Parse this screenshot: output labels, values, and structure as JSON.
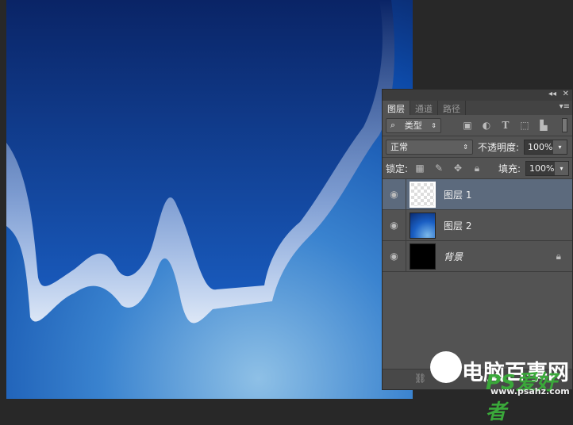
{
  "panel": {
    "tabs": [
      {
        "label": "图层",
        "active": true
      },
      {
        "label": "通道",
        "active": false
      },
      {
        "label": "路径",
        "active": false
      }
    ],
    "filter": {
      "label": "类型",
      "icons": [
        "image-filter-icon",
        "adjustment-filter-icon",
        "type-filter-icon",
        "shape-filter-icon",
        "smart-object-filter-icon"
      ]
    },
    "blend_mode": "正常",
    "opacity_label": "不透明度:",
    "opacity": "100%",
    "lock_label": "锁定:",
    "fill_label": "填充:",
    "fill": "100%",
    "layers": [
      {
        "name": "图层 1",
        "selected": true,
        "visible": true,
        "thumb": "transparent"
      },
      {
        "name": "图层 2",
        "selected": false,
        "visible": true,
        "thumb": "blue-gradient"
      },
      {
        "name": "背景",
        "selected": false,
        "visible": true,
        "locked": true,
        "thumb": "black"
      }
    ]
  },
  "watermarks": {
    "site1": "电脑百事网",
    "site2": "PS爱好者",
    "url": "www.psahz.com"
  },
  "colors": {
    "canvas_dark": "#0a2a6e",
    "canvas_light": "#6aa8d8",
    "selection": "#5c6a7d"
  }
}
